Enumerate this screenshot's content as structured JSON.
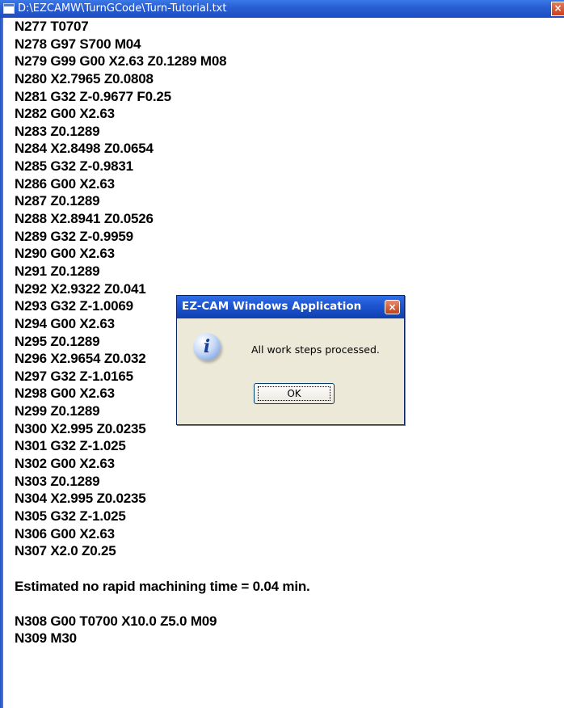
{
  "window": {
    "title": "D:\\EZCAMW\\TurnGCode\\Turn-Tutorial.txt",
    "close_glyph": "×"
  },
  "content": {
    "lines_a": [
      "N277 T0707",
      "N278 G97 S700 M04",
      "N279 G99 G00 X2.63 Z0.1289 M08",
      "N280 X2.7965 Z0.0808",
      "N281 G32 Z-0.9677 F0.25",
      "N282 G00 X2.63",
      "N283 Z0.1289",
      "N284 X2.8498 Z0.0654",
      "N285 G32 Z-0.9831",
      "N286 G00 X2.63",
      "N287 Z0.1289",
      "N288 X2.8941 Z0.0526",
      "N289 G32 Z-0.9959",
      "N290 G00 X2.63",
      "N291 Z0.1289",
      "N292 X2.9322 Z0.041",
      "N293 G32 Z-1.0069",
      "N294 G00 X2.63",
      "N295 Z0.1289",
      "N296 X2.9654 Z0.032",
      "N297 G32 Z-1.0165",
      "N298 G00 X2.63",
      "N299 Z0.1289",
      "N300 X2.995 Z0.0235",
      "N301 G32 Z-1.025",
      "N302 G00 X2.63",
      "N303 Z0.1289",
      "N304 X2.995 Z0.0235",
      "N305 G32 Z-1.025",
      "N306 G00 X2.63",
      "N307 X2.0 Z0.25"
    ],
    "estimate_line": "Estimated no rapid machining time = 0.04 min.",
    "lines_b": [
      "N308 G00 T0700 X10.0 Z5.0 M09",
      "N309 M30"
    ]
  },
  "dialog": {
    "title": "EZ-CAM Windows Application",
    "close_glyph": "×",
    "icon": "info-icon",
    "icon_glyph": "i",
    "message": "All work steps processed.",
    "ok_label": "OK"
  },
  "colors": {
    "titlebar": "#2a5fd4",
    "dialog_bg": "#ece9d8",
    "close_button": "#c8401f"
  }
}
